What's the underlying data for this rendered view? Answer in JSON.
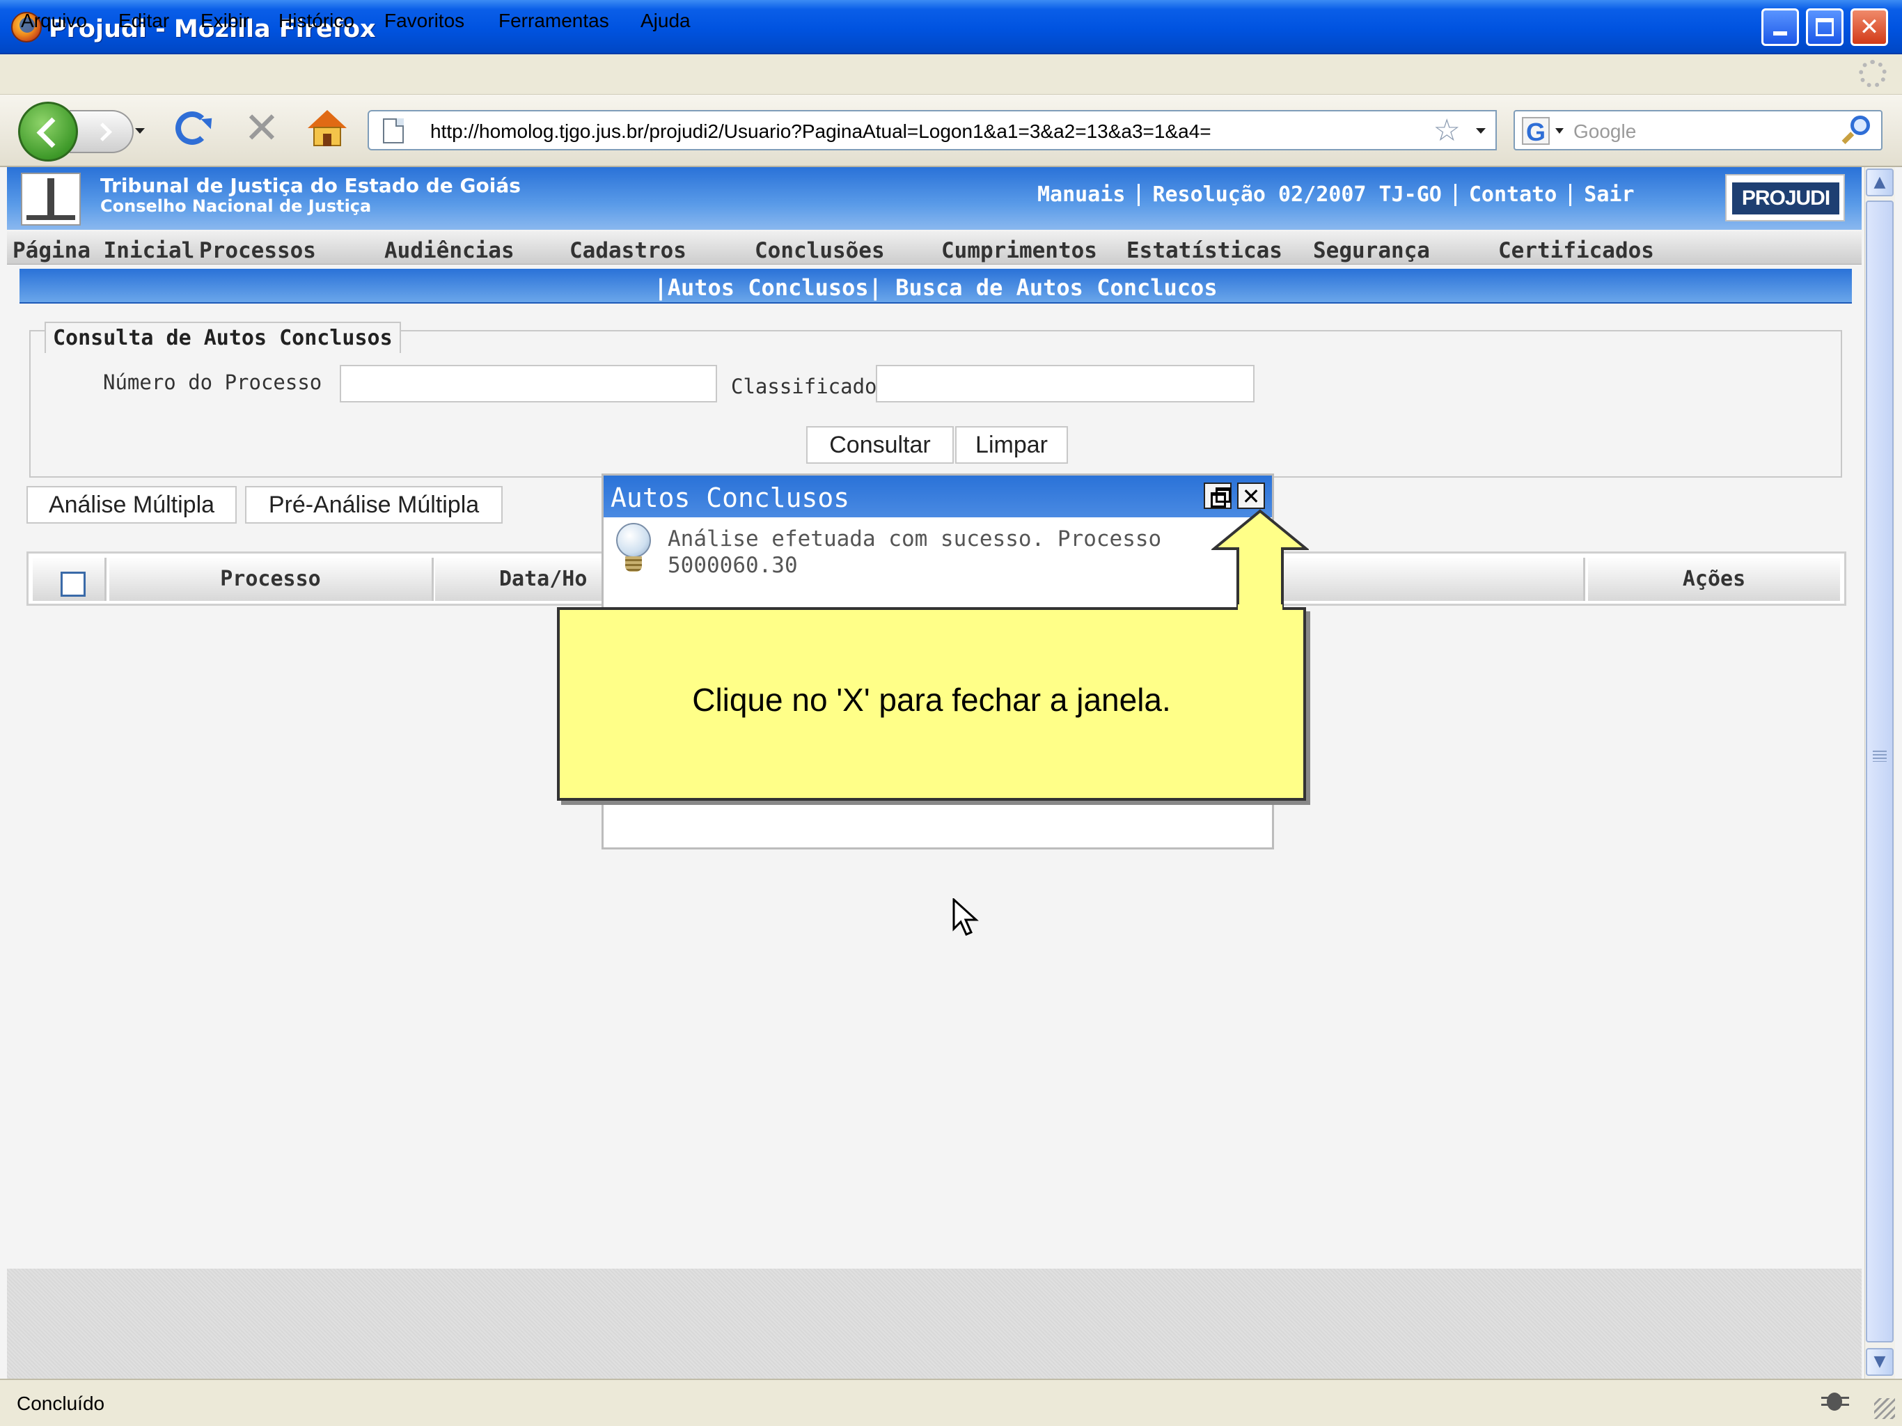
{
  "window": {
    "title": "Projudi - Mozilla Firefox"
  },
  "menubar": {
    "items": [
      "Arquivo",
      "Editar",
      "Exibir",
      "Histórico",
      "Favoritos",
      "Ferramentas",
      "Ajuda"
    ]
  },
  "navbar": {
    "url": "http://homolog.tjgo.jus.br/projudi2/Usuario?PaginaAtual=Logon1&a1=3&a2=13&a3=1&a4=",
    "search_placeholder": "Google"
  },
  "banner": {
    "institution_line1": "Tribunal de Justiça do Estado de Goiás",
    "institution_line2": "Conselho Nacional de Justiça",
    "links": [
      "Manuais",
      "Resolução 02/2007 TJ-GO",
      "Contato",
      "Sair"
    ],
    "logo_text": "PROJUDI"
  },
  "mainnav": {
    "items": [
      "Página Inicial",
      "Processos",
      "Audiências",
      "Cadastros",
      "Conclusões",
      "Cumprimentos",
      "Estatísticas",
      "Segurança",
      "Certificados"
    ]
  },
  "section": {
    "title": "|Autos Conclusos| Busca de Autos Conclucos"
  },
  "form": {
    "legend": "Consulta de Autos Conclusos",
    "numero_label": "Número do Processo",
    "numero_value": "",
    "classificador_label": "Classificador",
    "classificador_value": "",
    "consultar_label": "Consultar",
    "limpar_label": "Limpar"
  },
  "actions": {
    "analise_multipla": "Análise Múltipla",
    "pre_analise_multipla": "Pré-Análise Múltipla"
  },
  "table": {
    "headers": [
      "Processo",
      "Data/Ho",
      "Ações"
    ]
  },
  "popup": {
    "title": "Autos Conclusos",
    "message_line1": "Análise efetuada com sucesso. Processo",
    "message_line2": "5000060.30"
  },
  "callout": {
    "text": "Clique no 'X' para fechar a janela."
  },
  "statusbar": {
    "text": "Concluído"
  },
  "colors": {
    "titlebar": "#0053e0",
    "banner": "#2a72d8",
    "callout": "#ffff88"
  }
}
